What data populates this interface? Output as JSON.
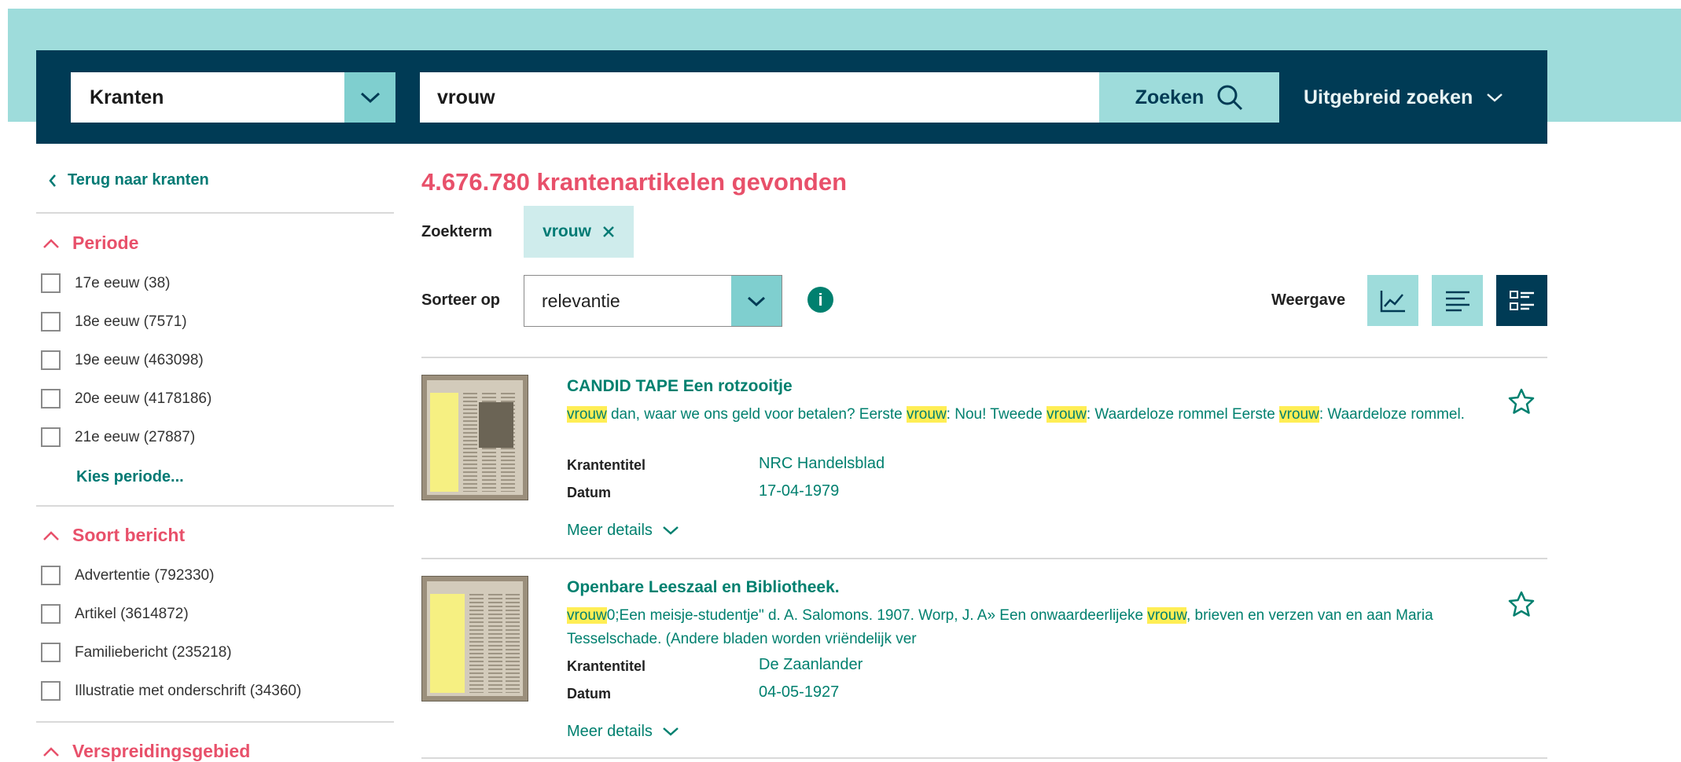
{
  "search": {
    "collection": "Kranten",
    "query": "vrouw",
    "search_label": "Zoeken",
    "advanced_label": "Uitgebreid zoeken"
  },
  "sidebar": {
    "back_label": "Terug naar kranten",
    "period": {
      "title": "Periode",
      "items": [
        "17e eeuw (38)",
        "18e eeuw (7571)",
        "19e eeuw (463098)",
        "20e eeuw (4178186)",
        "21e eeuw (27887)"
      ],
      "more_label": "Kies periode..."
    },
    "type": {
      "title": "Soort bericht",
      "items": [
        "Advertentie (792330)",
        "Artikel (3614872)",
        "Familiebericht (235218)",
        "Illustratie met onderschrift (34360)"
      ]
    },
    "region": {
      "title": "Verspreidingsgebied"
    }
  },
  "main": {
    "result_count": "4.676.780 krantenartikelen gevonden",
    "term_label": "Zoekterm",
    "term_chip": "vrouw",
    "sort_label": "Sorteer op",
    "sort_value": "relevantie",
    "info_glyph": "i",
    "view_label": "Weergave"
  },
  "results": [
    {
      "title": "CANDID TAPE Een rotzooitje",
      "snippet": [
        {
          "text": "vrouw",
          "hl": true
        },
        {
          "text": " dan, waar we ons geld voor betalen? Eerste ",
          "hl": false
        },
        {
          "text": "vrouw",
          "hl": true
        },
        {
          "text": ": Nou! Tweede ",
          "hl": false
        },
        {
          "text": "vrouw",
          "hl": true
        },
        {
          "text": ": Waardeloze rommel Eerste ",
          "hl": false
        },
        {
          "text": "vrouw",
          "hl": true
        },
        {
          "text": ": Waardeloze rommel.",
          "hl": false
        }
      ],
      "newspaper_label": "Krantentitel",
      "newspaper": "NRC Handelsblad",
      "date_label": "Datum",
      "date": "17-04-1979",
      "details_label": "Meer details"
    },
    {
      "title": "Openbare Leeszaal en Bibliotheek.",
      "snippet": [
        {
          "text": "vrouw",
          "hl": true
        },
        {
          "text": "0;Een meisje-studentje\" d. A. Salomons. 1907. Worp, J. A» Een onwaardeerlijeke ",
          "hl": false
        },
        {
          "text": "vrouw",
          "hl": true
        },
        {
          "text": ", brieven en verzen van en aan Maria Tesselschade. (Andere bladen worden vriëndelijk ver",
          "hl": false
        }
      ],
      "newspaper_label": "Krantentitel",
      "newspaper": "De Zaanlander",
      "date_label": "Datum",
      "date": "04-05-1927",
      "details_label": "Meer details"
    }
  ],
  "colors": {
    "navy": "#003b55",
    "teal_light": "#9edcdb",
    "teal_text": "#00806f",
    "pink": "#e8506a",
    "highlight": "#ffee55"
  }
}
